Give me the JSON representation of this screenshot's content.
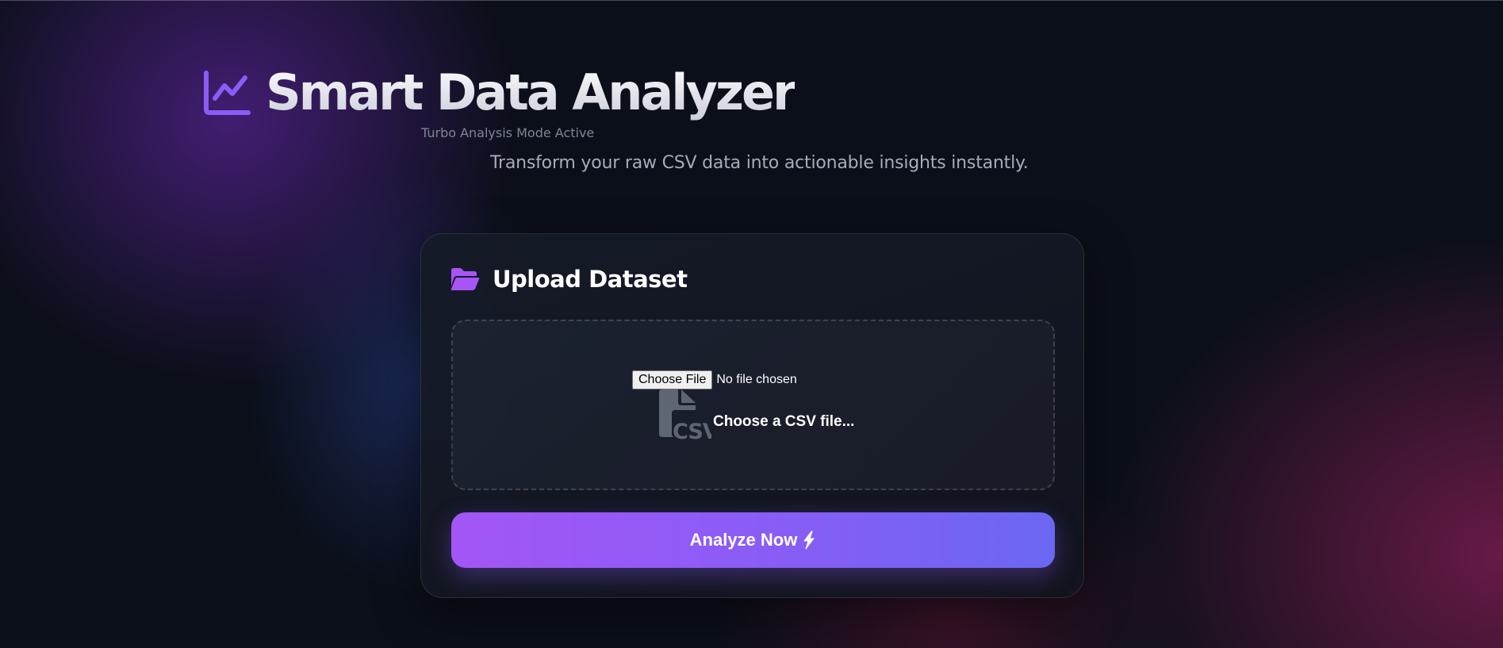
{
  "header": {
    "title": "Smart Data Analyzer",
    "mode_badge": "Turbo Analysis Mode Active",
    "tagline": "Transform your raw CSV data into actionable insights instantly.",
    "icon": "chart-line-icon"
  },
  "upload": {
    "title": "Upload Dataset",
    "title_icon": "folder-open-icon",
    "file_input": {
      "button_label": "Choose File",
      "status": "No file chosen"
    },
    "csv_icon": "file-csv-icon",
    "prompt": "Choose a CSV file..."
  },
  "actions": {
    "analyze_label": "Analyze Now",
    "analyze_icon": "bolt-icon"
  },
  "colors": {
    "accent_purple": "#a356f5",
    "accent_indigo": "#6a67f2",
    "background": "#0b0f19",
    "icon_purple": "#8b5cf6",
    "folder_purple": "#a855f7"
  }
}
